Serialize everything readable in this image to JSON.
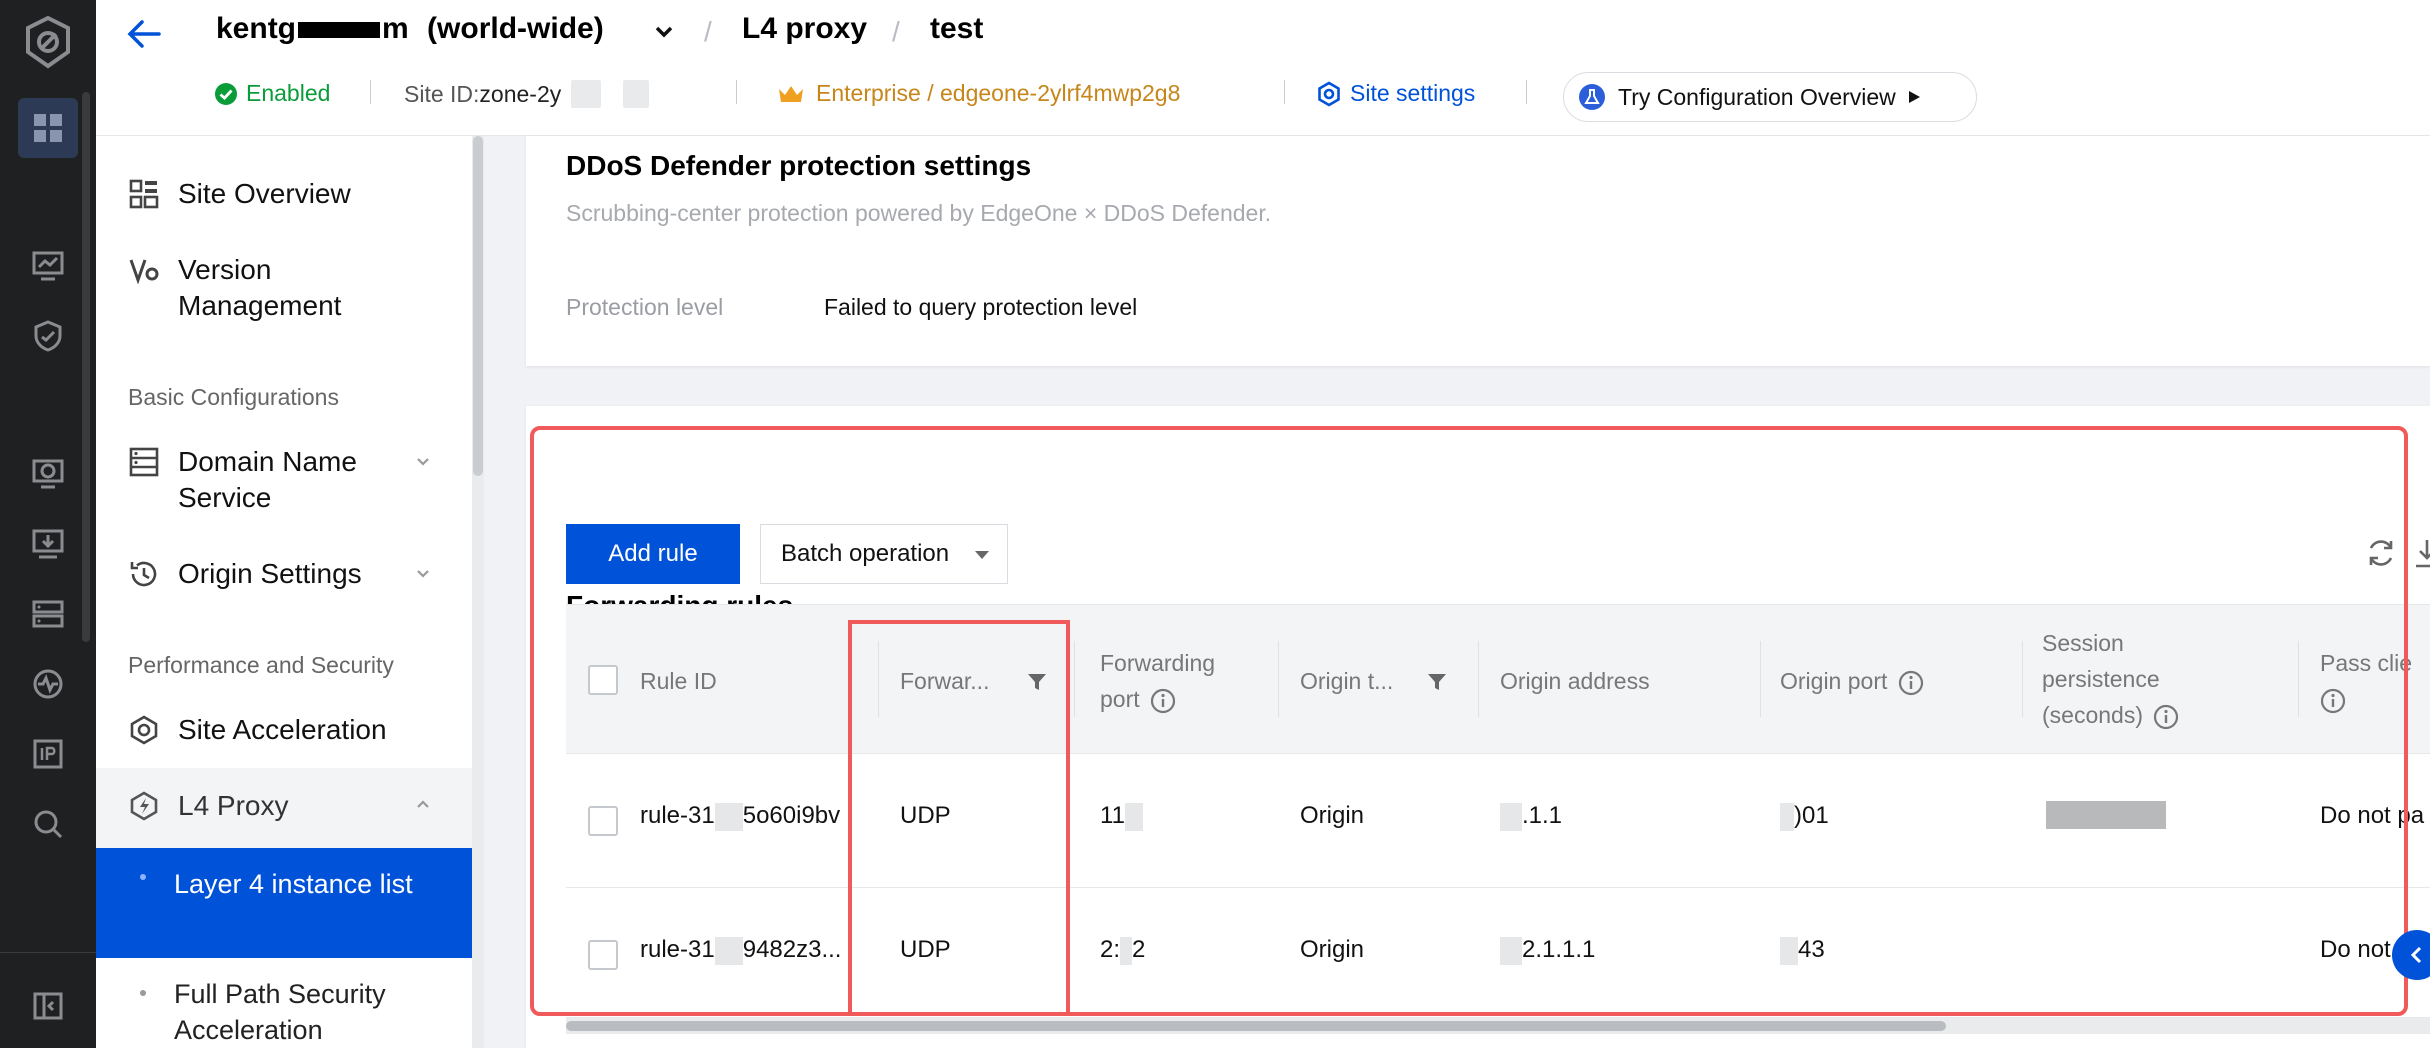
{
  "header": {
    "site_name_prefix": "kentg",
    "site_name_suffix": "m",
    "site_scope": "(world-wide)",
    "crumb_2": "L4 proxy",
    "crumb_3": "test",
    "crumb_separator": "/",
    "status": "Enabled",
    "site_id_label": "Site ID:",
    "site_id_value": "zone-2y",
    "plan": "Enterprise / edgeone-2ylrf4mwp2g8",
    "site_settings": "Site settings",
    "try_overview": "Try Configuration Overview",
    "accent": "#0052d9",
    "status_color": "#0b9c3a",
    "plan_color": "#c6861a"
  },
  "sidebar": {
    "items": [
      {
        "label": "Site Overview",
        "icon": "grid-icon"
      },
      {
        "label": "Version Management",
        "icon": "version-icon"
      }
    ],
    "section_basic": "Basic Configurations",
    "basic_items": [
      {
        "label": "Domain Name Service",
        "icon": "server-icon"
      },
      {
        "label": "Origin Settings",
        "icon": "history-icon"
      }
    ],
    "section_perf": "Performance and Security",
    "perf_items": [
      {
        "label": "Site Acceleration",
        "icon": "acceleration-icon"
      },
      {
        "label": "L4 Proxy",
        "icon": "lightning-icon"
      }
    ],
    "sub_items": [
      {
        "label": "Layer 4 instance list",
        "active": true
      },
      {
        "label": "Full Path Security Acceleration",
        "active": false
      }
    ]
  },
  "ddos": {
    "title": "DDoS Defender protection settings",
    "description": "Scrubbing-center protection powered by EdgeOne × DDoS Defender.",
    "protection_label": "Protection level",
    "protection_value": "Failed to query protection level"
  },
  "rules": {
    "title": "Forwarding rules",
    "add_rule": "Add rule",
    "batch_operation": "Batch operation",
    "columns": {
      "rule_id": "Rule ID",
      "forwarding_protocol": "Forwar...",
      "forwarding_port_l1": "Forwarding",
      "forwarding_port_l2": "port",
      "origin_type": "Origin t...",
      "origin_address": "Origin address",
      "origin_port": "Origin port",
      "session_l1": "Session",
      "session_l2": "persistence",
      "session_l3": "(seconds)",
      "pass_l1": "Pass clie"
    },
    "rows": [
      {
        "rule_id_a": "rule-31",
        "rule_id_b": "5o60i9bv",
        "protocol": "UDP",
        "port": "11",
        "origin_type": "Origin",
        "origin_address": ".1.1",
        "origin_port": ")01",
        "pass": "Do not pa"
      },
      {
        "rule_id_a": "rule-31",
        "rule_id_b": "9482z3...",
        "protocol": "UDP",
        "port_a": "2:",
        "port_b": "2",
        "origin_type": "Origin",
        "origin_address": "2.1.1.1",
        "origin_port": "43",
        "pass": "Do not"
      }
    ]
  }
}
